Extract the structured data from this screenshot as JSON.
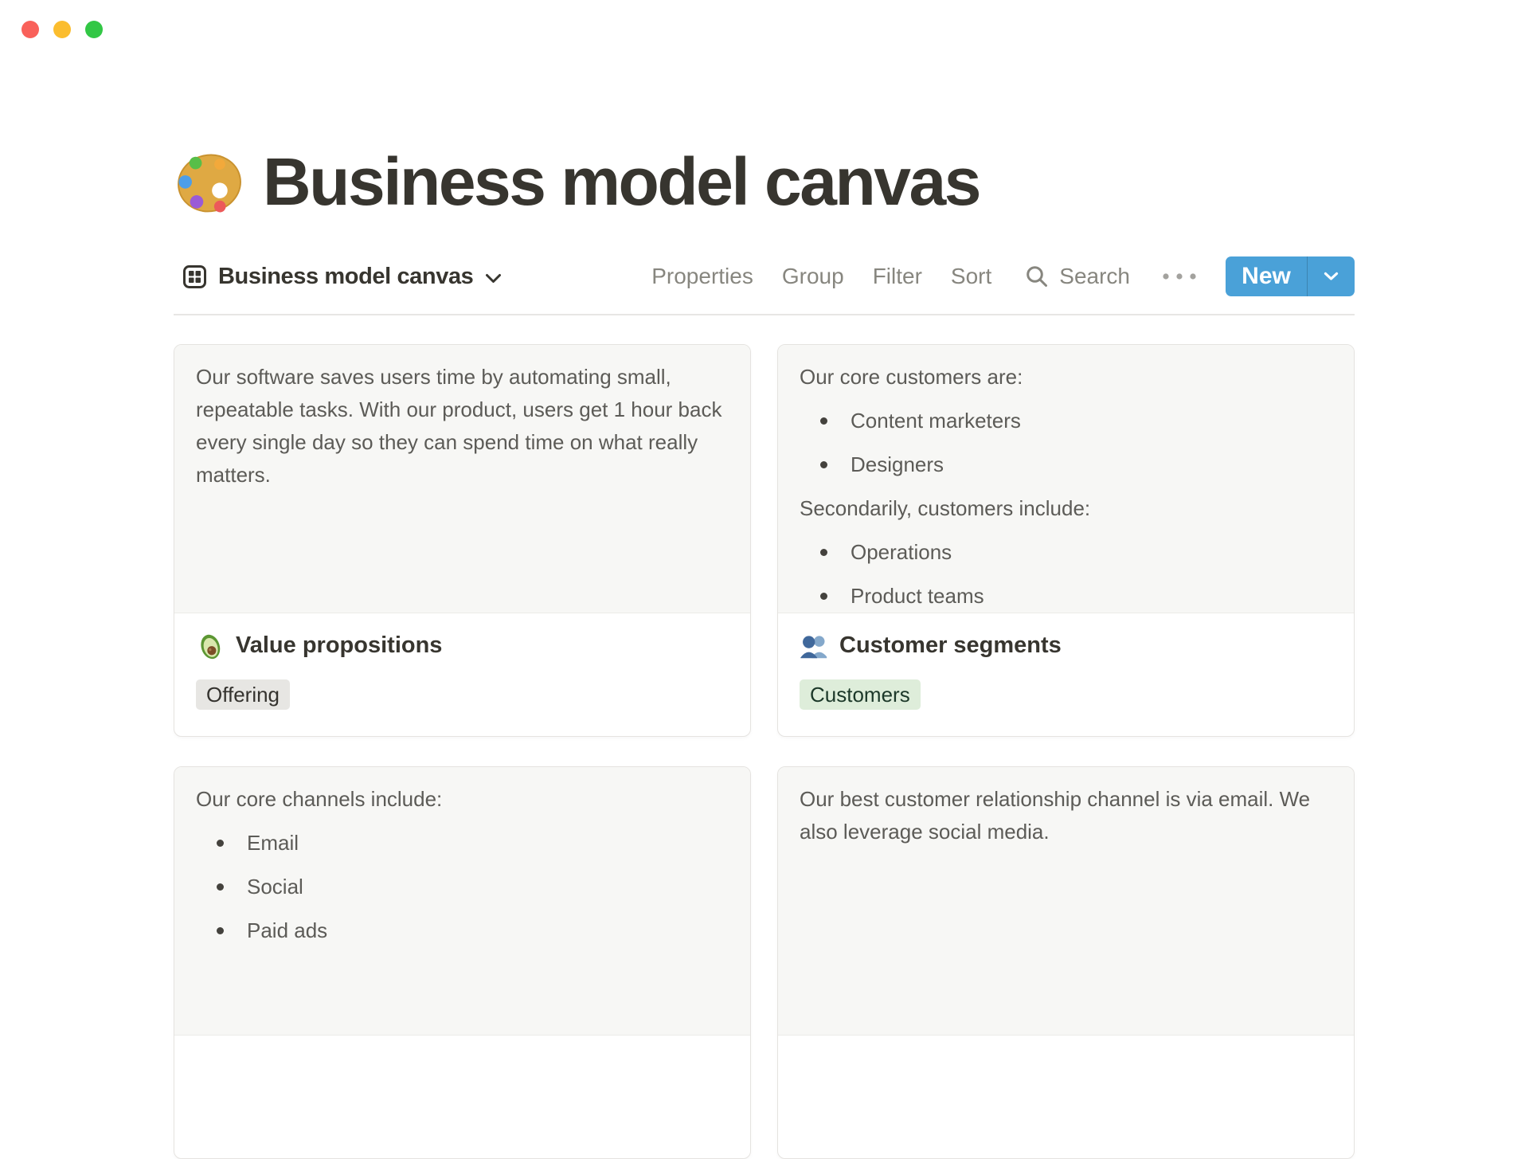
{
  "window": {
    "controls": [
      {
        "name": "close",
        "color": "#F9615A"
      },
      {
        "name": "minimize",
        "color": "#FBBD2E"
      },
      {
        "name": "zoom",
        "color": "#32C745"
      }
    ]
  },
  "header": {
    "icon": "palette-emoji",
    "title": "Business model canvas"
  },
  "toolbar": {
    "view_icon": "gallery-grid-icon",
    "view_name": "Business model canvas",
    "actions": [
      "Properties",
      "Group",
      "Filter",
      "Sort"
    ],
    "search_label": "Search",
    "more_icon": "ellipsis-icon",
    "new_label": "New",
    "accent_color": "#4AA1D8"
  },
  "cards": [
    {
      "title": "Value propositions",
      "icon": "avocado-emoji",
      "tag": {
        "label": "Offering",
        "bg": "#E7E6E3",
        "text_color": "#34322E"
      },
      "preview_blocks": [
        {
          "type": "p",
          "text": "Our software saves users time by automating small, repeatable tasks. With our product, users get 1 hour back every single day so they can spend time on what really matters."
        }
      ]
    },
    {
      "title": "Customer segments",
      "icon": "busts-emoji",
      "tag": {
        "label": "Customers",
        "bg": "#DEEDDA",
        "text_color": "#1C3829"
      },
      "preview_blocks": [
        {
          "type": "p",
          "text": "Our core customers are:"
        },
        {
          "type": "li",
          "text": "Content marketers"
        },
        {
          "type": "li",
          "text": "Designers"
        },
        {
          "type": "p",
          "text": "Secondarily, customers include:"
        },
        {
          "type": "li",
          "text": "Operations"
        },
        {
          "type": "li",
          "text": "Product teams"
        }
      ]
    },
    {
      "preview_blocks": [
        {
          "type": "p",
          "text": "Our core channels include:"
        },
        {
          "type": "li",
          "text": "Email"
        },
        {
          "type": "li",
          "text": "Social"
        },
        {
          "type": "li",
          "text": "Paid ads"
        }
      ]
    },
    {
      "preview_blocks": [
        {
          "type": "p",
          "text": "Our best customer relationship channel is via email. We also leverage social media."
        }
      ]
    }
  ],
  "colors": {
    "page_bg": "#FFFFFF",
    "card_preview_bg": "#F7F7F5",
    "card_border": "#E5E3E0",
    "divider": "#E7E6E4",
    "text_dark": "#37352F",
    "text_gray": "#5C5B57",
    "toolbar_gray": "#87867F"
  }
}
